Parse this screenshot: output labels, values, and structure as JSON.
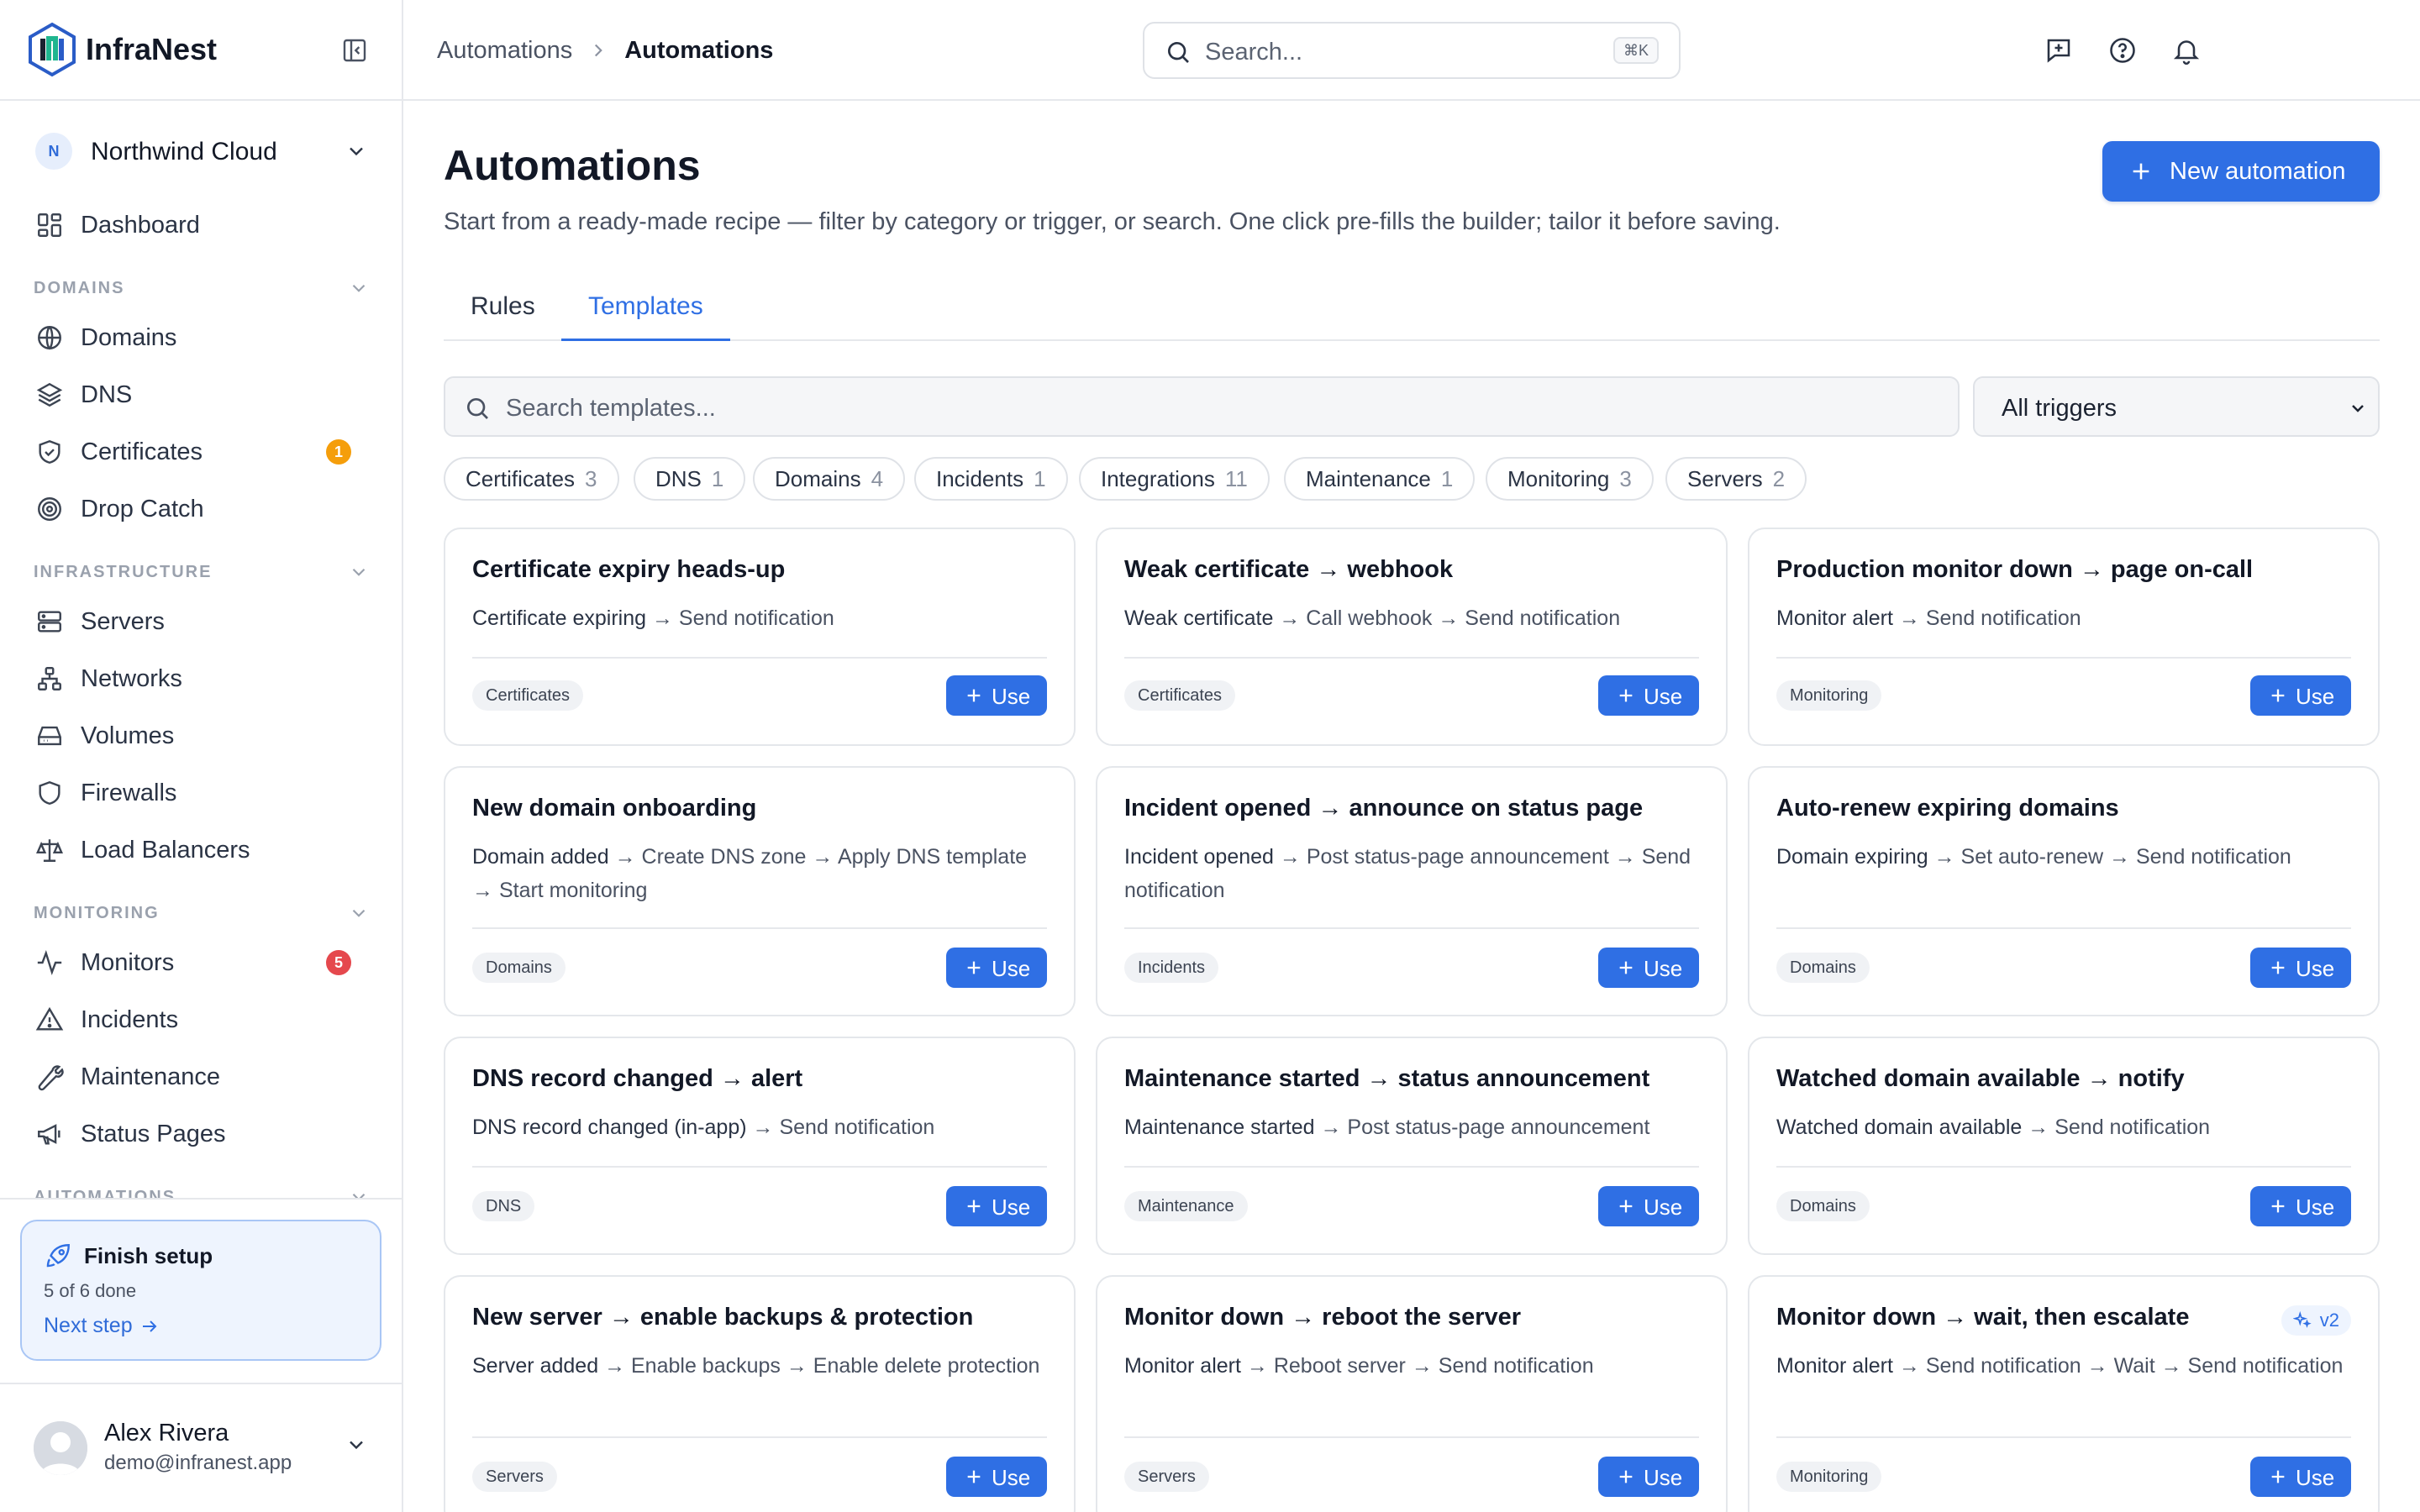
{
  "brand": {
    "name": "InfraNest"
  },
  "org": {
    "initial": "N",
    "name": "Northwind Cloud"
  },
  "nav": {
    "dashboard": "Dashboard",
    "sections": {
      "domains": "DOMAINS",
      "infrastructure": "INFRASTRUCTURE",
      "monitoring": "MONITORING",
      "automations": "AUTOMATIONS"
    },
    "domains_items": [
      {
        "label": "Domains",
        "icon": "globe-icon"
      },
      {
        "label": "DNS",
        "icon": "layers-icon"
      },
      {
        "label": "Certificates",
        "icon": "shield-check-icon",
        "badge": "1"
      },
      {
        "label": "Drop Catch",
        "icon": "target-icon"
      }
    ],
    "infrastructure_items": [
      {
        "label": "Servers",
        "icon": "server-icon"
      },
      {
        "label": "Networks",
        "icon": "network-icon"
      },
      {
        "label": "Volumes",
        "icon": "hard-drive-icon"
      },
      {
        "label": "Firewalls",
        "icon": "shield-icon"
      },
      {
        "label": "Load Balancers",
        "icon": "scale-icon"
      }
    ],
    "monitoring_items": [
      {
        "label": "Monitors",
        "icon": "activity-icon",
        "badge": "5"
      },
      {
        "label": "Incidents",
        "icon": "alert-triangle-icon"
      },
      {
        "label": "Maintenance",
        "icon": "wrench-icon"
      },
      {
        "label": "Status Pages",
        "icon": "megaphone-icon"
      }
    ]
  },
  "setup": {
    "title": "Finish setup",
    "progress_text": "5 of 6 done",
    "link": "Next step"
  },
  "user": {
    "name": "Alex Rivera",
    "email": "demo@infranest.app"
  },
  "topbar": {
    "breadcrumb": [
      "Automations",
      "Automations"
    ],
    "search_placeholder": "Search...",
    "shortcut": "⌘K"
  },
  "page": {
    "title": "Automations",
    "subtitle": "Start from a ready-made recipe — filter by category or trigger, or search. One click pre-fills the builder; tailor it before saving.",
    "new_button": "New automation",
    "tabs": [
      "Rules",
      "Templates"
    ],
    "active_tab": "Templates",
    "template_search_placeholder": "Search templates...",
    "trigger_filter": "All triggers"
  },
  "categories": [
    {
      "name": "Certificates",
      "count": "3"
    },
    {
      "name": "DNS",
      "count": "1"
    },
    {
      "name": "Domains",
      "count": "4"
    },
    {
      "name": "Incidents",
      "count": "1"
    },
    {
      "name": "Integrations",
      "count": "11"
    },
    {
      "name": "Maintenance",
      "count": "1"
    },
    {
      "name": "Monitoring",
      "count": "3"
    },
    {
      "name": "Servers",
      "count": "2"
    }
  ],
  "use_label": "Use",
  "templates": [
    {
      "title": "Certificate expiry heads-up",
      "trigger": "Certificate expiring",
      "steps": "→ Send notification",
      "tag": "Certificates"
    },
    {
      "title": "Weak certificate → webhook",
      "trigger": "Weak certificate",
      "steps": "→ Call webhook → Send notification",
      "tag": "Certificates"
    },
    {
      "title": "Production monitor down → page on-call",
      "trigger": "Monitor alert",
      "steps": "→ Send notification",
      "tag": "Monitoring"
    },
    {
      "title": "New domain onboarding",
      "trigger": "Domain added",
      "steps": "→ Create DNS zone → Apply DNS template → Start monitoring",
      "tag": "Domains"
    },
    {
      "title": "Incident opened → announce on status page",
      "trigger": "Incident opened",
      "steps": "→ Post status-page announcement → Send notification",
      "tag": "Incidents"
    },
    {
      "title": "Auto-renew expiring domains",
      "trigger": "Domain expiring",
      "steps": "→ Set auto-renew → Send notification",
      "tag": "Domains"
    },
    {
      "title": "DNS record changed → alert",
      "trigger": "DNS record changed (in-app)",
      "steps": "→ Send notification",
      "tag": "DNS"
    },
    {
      "title": "Maintenance started → status announcement",
      "trigger": "Maintenance started",
      "steps": "→ Post status-page announcement",
      "tag": "Maintenance"
    },
    {
      "title": "Watched domain available → notify",
      "trigger": "Watched domain available",
      "steps": "→ Send notification",
      "tag": "Domains"
    },
    {
      "title": "New server → enable backups & protection",
      "trigger": "Server added",
      "steps": "→ Enable backups → Enable delete protection",
      "tag": "Servers"
    },
    {
      "title": "Monitor down → reboot the server",
      "trigger": "Monitor alert",
      "steps": "→ Reboot server → Send notification",
      "tag": "Servers"
    },
    {
      "title": "Monitor down → wait, then escalate",
      "trigger": "Monitor alert",
      "steps": "→ Send notification → Wait → Send notification",
      "tag": "Monitoring",
      "badge": "v2"
    }
  ],
  "colors": {
    "accent": "#2f6fe4",
    "badge_orange": "#f59e0b",
    "badge_red": "#e5484d",
    "text": "#121826",
    "muted": "#4a5262",
    "border": "#e4e7eb"
  }
}
